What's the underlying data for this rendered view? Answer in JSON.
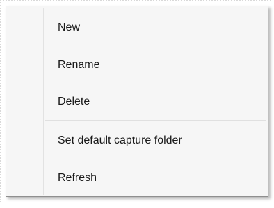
{
  "context_menu": {
    "items": [
      {
        "label": "New"
      },
      {
        "label": "Rename"
      },
      {
        "label": "Delete"
      },
      {
        "label": "Set default capture folder"
      },
      {
        "label": "Refresh"
      }
    ]
  }
}
